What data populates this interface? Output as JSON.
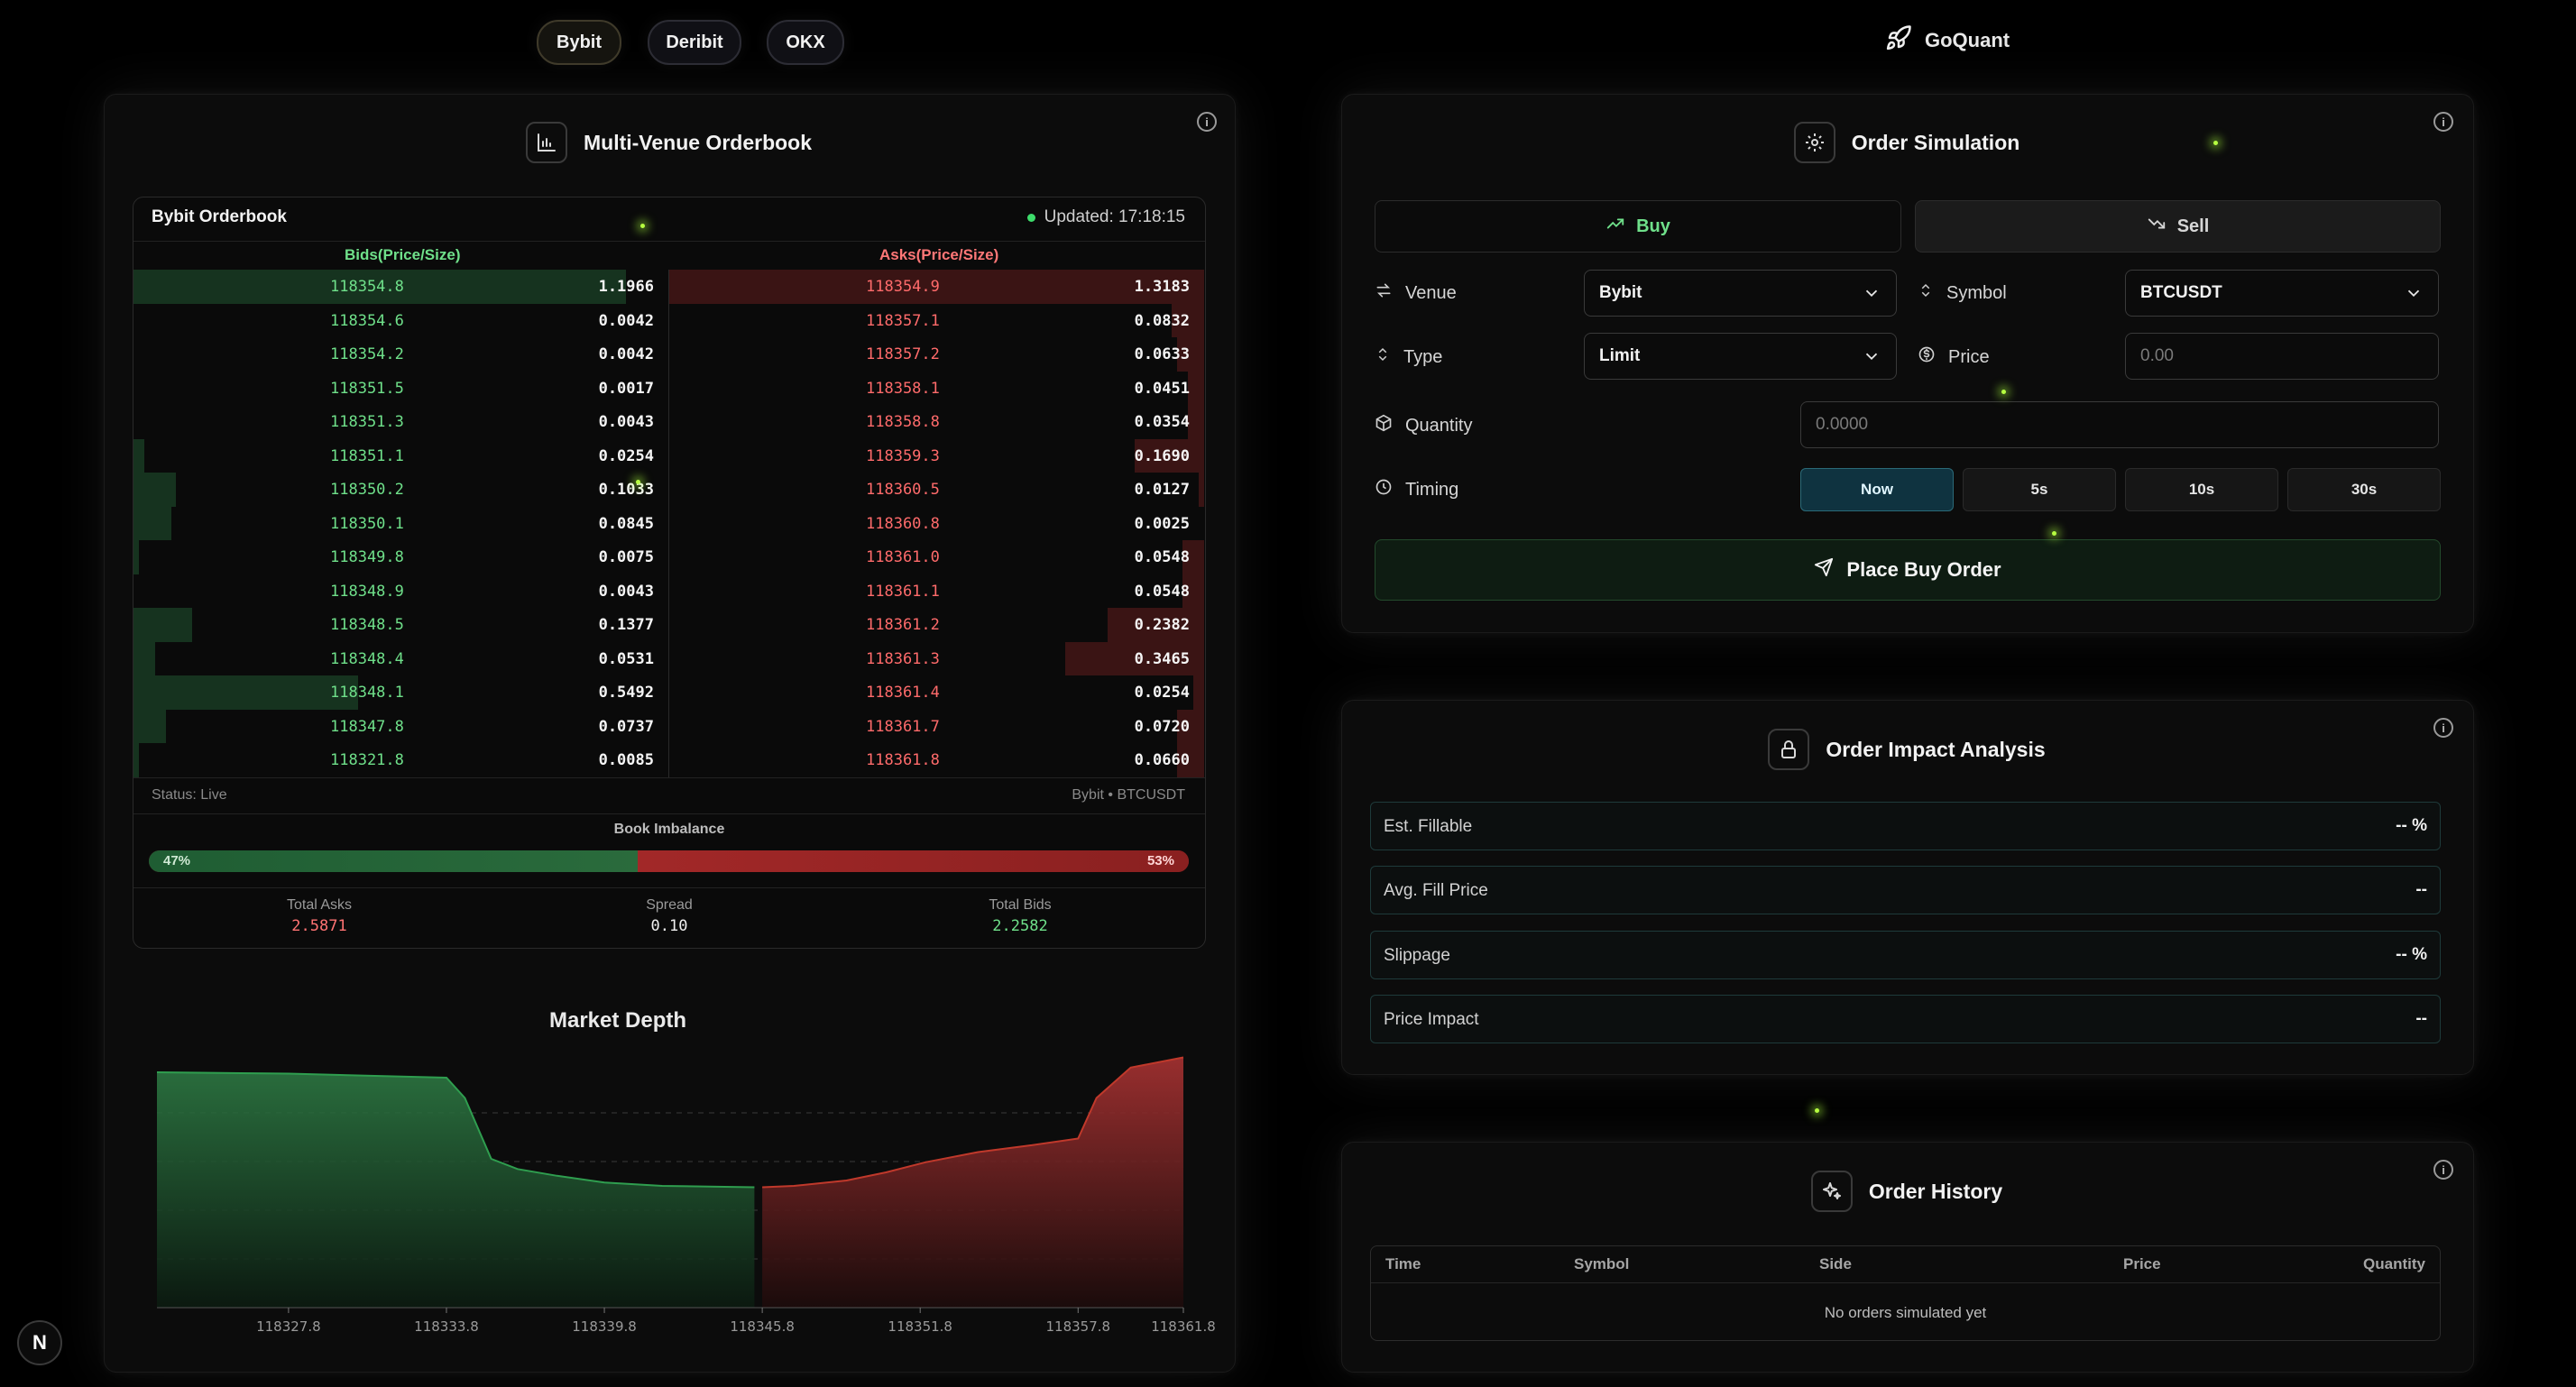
{
  "venues": [
    "Bybit",
    "Deribit",
    "OKX"
  ],
  "brand": "GoQuant",
  "orderbook_panel": {
    "title": "Multi-Venue Orderbook",
    "book_title": "Bybit Orderbook",
    "updated": "Updated: 17:18:15",
    "bids_header": "Bids(Price/Size)",
    "asks_header": "Asks(Price/Size)",
    "bids": [
      {
        "price": "118354.8",
        "size": "1.1966",
        "depth": 0.92
      },
      {
        "price": "118354.6",
        "size": "0.0042",
        "depth": 0.0
      },
      {
        "price": "118354.2",
        "size": "0.0042",
        "depth": 0.0
      },
      {
        "price": "118351.5",
        "size": "0.0017",
        "depth": 0.0
      },
      {
        "price": "118351.3",
        "size": "0.0043",
        "depth": 0.0
      },
      {
        "price": "118351.1",
        "size": "0.0254",
        "depth": 0.02
      },
      {
        "price": "118350.2",
        "size": "0.1033",
        "depth": 0.08
      },
      {
        "price": "118350.1",
        "size": "0.0845",
        "depth": 0.07
      },
      {
        "price": "118349.8",
        "size": "0.0075",
        "depth": 0.01
      },
      {
        "price": "118348.9",
        "size": "0.0043",
        "depth": 0.0
      },
      {
        "price": "118348.5",
        "size": "0.1377",
        "depth": 0.11
      },
      {
        "price": "118348.4",
        "size": "0.0531",
        "depth": 0.04
      },
      {
        "price": "118348.1",
        "size": "0.5492",
        "depth": 0.42
      },
      {
        "price": "118347.8",
        "size": "0.0737",
        "depth": 0.06
      },
      {
        "price": "118321.8",
        "size": "0.0085",
        "depth": 0.01
      }
    ],
    "asks": [
      {
        "price": "118354.9",
        "size": "1.3183",
        "depth": 1.0
      },
      {
        "price": "118357.1",
        "size": "0.0832",
        "depth": 0.06
      },
      {
        "price": "118357.2",
        "size": "0.0633",
        "depth": 0.05
      },
      {
        "price": "118358.1",
        "size": "0.0451",
        "depth": 0.03
      },
      {
        "price": "118358.8",
        "size": "0.0354",
        "depth": 0.03
      },
      {
        "price": "118359.3",
        "size": "0.1690",
        "depth": 0.13
      },
      {
        "price": "118360.5",
        "size": "0.0127",
        "depth": 0.01
      },
      {
        "price": "118360.8",
        "size": "0.0025",
        "depth": 0.0
      },
      {
        "price": "118361.0",
        "size": "0.0548",
        "depth": 0.04
      },
      {
        "price": "118361.1",
        "size": "0.0548",
        "depth": 0.04
      },
      {
        "price": "118361.2",
        "size": "0.2382",
        "depth": 0.18
      },
      {
        "price": "118361.3",
        "size": "0.3465",
        "depth": 0.26
      },
      {
        "price": "118361.4",
        "size": "0.0254",
        "depth": 0.02
      },
      {
        "price": "118361.7",
        "size": "0.0720",
        "depth": 0.05
      },
      {
        "price": "118361.8",
        "size": "0.0660",
        "depth": 0.05
      }
    ],
    "status": "Status: Live",
    "venue_symbol": "Bybit • BTCUSDT",
    "imbalance_title": "Book Imbalance",
    "imbalance_bid_pct": "47%",
    "imbalance_ask_pct": "53%",
    "imbalance_bid_fraction": 0.47,
    "total_asks_label": "Total Asks",
    "total_asks": "2.5871",
    "spread_label": "Spread",
    "spread": "0.10",
    "total_bids_label": "Total Bids",
    "total_bids": "2.2582"
  },
  "market_depth": {
    "title": "Market Depth",
    "colors": {
      "bids": "#2f9e4f",
      "asks": "#c0392b"
    }
  },
  "chart_data": {
    "type": "area",
    "title": "Market Depth",
    "xlabel": "",
    "ylabel": "",
    "x_ticks": [
      "118327.8",
      "118333.8",
      "118339.8",
      "118345.8",
      "118351.8",
      "118357.8",
      "118361.8"
    ],
    "xlim": [
      118322.8,
      118361.8
    ],
    "ylim": [
      0,
      3.6
    ],
    "grid": true,
    "series": [
      {
        "x": [
          118322.8,
          118327.8,
          118333.8,
          118334.5,
          118335.5,
          118336.5,
          118338,
          118339.8,
          118342,
          118345.5
        ],
        "y": [
          3.48,
          3.46,
          3.4,
          3.1,
          2.2,
          2.05,
          1.95,
          1.85,
          1.8,
          1.78
        ]
      },
      {
        "x": [
          118345.8,
          118347,
          118349,
          118350.5,
          118352,
          118354,
          118356,
          118357.8,
          118358.5,
          118359.8,
          118361.8
        ],
        "y": [
          1.78,
          1.8,
          1.88,
          2.0,
          2.15,
          2.3,
          2.4,
          2.5,
          3.1,
          3.55,
          3.7
        ]
      }
    ]
  },
  "simulation": {
    "title": "Order Simulation",
    "buy_label": "Buy",
    "sell_label": "Sell",
    "venue_label": "Venue",
    "venue_value": "Bybit",
    "symbol_label": "Symbol",
    "symbol_value": "BTCUSDT",
    "type_label": "Type",
    "type_value": "Limit",
    "price_label": "Price",
    "price_placeholder": "0.00",
    "quantity_label": "Quantity",
    "quantity_placeholder": "0.0000",
    "timing_label": "Timing",
    "timing_options": [
      "Now",
      "5s",
      "10s",
      "30s"
    ],
    "place_label": "Place Buy Order"
  },
  "impact": {
    "title": "Order Impact Analysis",
    "metrics": [
      {
        "label": "Est. Fillable",
        "value": "-- %"
      },
      {
        "label": "Avg. Fill Price",
        "value": "--"
      },
      {
        "label": "Slippage",
        "value": "-- %"
      },
      {
        "label": "Price Impact",
        "value": "--"
      }
    ]
  },
  "history": {
    "title": "Order History",
    "columns": [
      "Time",
      "Symbol",
      "Side",
      "Price",
      "Quantity"
    ],
    "empty": "No orders simulated yet"
  },
  "next_badge": "N"
}
